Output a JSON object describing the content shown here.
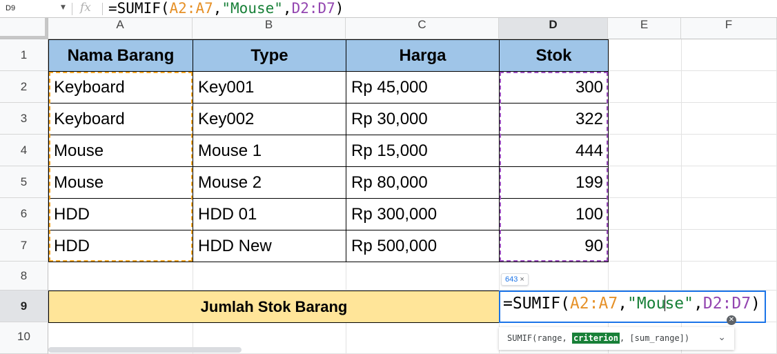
{
  "formula_bar": {
    "name_box": "D9",
    "fx_label": "fx",
    "formula": {
      "prefix": "=SUMIF(",
      "range1": "A2:A7",
      "comma1": ",",
      "criterion": "\"Mouse\"",
      "comma2": ",",
      "range2": "D2:D7",
      "suffix": ")"
    }
  },
  "columns": [
    "A",
    "B",
    "C",
    "D",
    "E",
    "F"
  ],
  "rows": [
    "1",
    "2",
    "3",
    "4",
    "5",
    "6",
    "7",
    "8",
    "9",
    "10"
  ],
  "table": {
    "headers": [
      "Nama Barang",
      "Type",
      "Harga",
      "Stok"
    ],
    "rows": [
      [
        "Keyboard",
        "Key001",
        "Rp 45,000",
        "300"
      ],
      [
        "Keyboard",
        "Key002",
        "Rp 30,000",
        "322"
      ],
      [
        "Mouse",
        "Mouse 1",
        "Rp 15,000",
        "444"
      ],
      [
        "Mouse",
        "Mouse 2",
        "Rp 80,000",
        "199"
      ],
      [
        "HDD",
        "HDD 01",
        "Rp 300,000",
        "100"
      ],
      [
        "HDD",
        "HDD New",
        "Rp 500,000",
        "90"
      ]
    ]
  },
  "total_label": "Jumlah Stok Barang",
  "edit_cell": {
    "prefix": "=SUMIF(",
    "range1": "A2:A7",
    "comma1": ",",
    "criterion_before_caret": "\"Mou",
    "criterion_after_caret": "se\"",
    "comma2": ",",
    "range2": "D2:D7",
    "suffix": ")"
  },
  "result_chip": {
    "value": "643",
    "close": "×"
  },
  "function_hint": {
    "name": "SUMIF(",
    "arg1": "range, ",
    "arg_active": "criterion",
    "arg3": ", [sum_range])",
    "chevron": "⌄"
  },
  "colors": {
    "header_fill": "#9fc5e8",
    "total_fill": "#ffe599",
    "range1_color": "#e69128",
    "range2_color": "#9345b0",
    "selection_blue": "#1a73e8"
  }
}
